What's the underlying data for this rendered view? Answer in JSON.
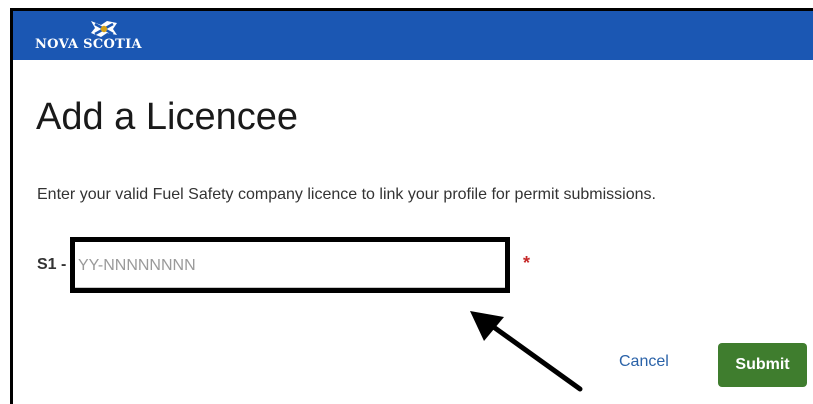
{
  "header": {
    "logo_text": "NOVA SCOTIA",
    "logo_icon": "nova-scotia-flag-icon",
    "background_color": "#1b57b3"
  },
  "main": {
    "title": "Add a Licencee",
    "instructions": "Enter your valid Fuel Safety company licence to link your profile for permit submissions.",
    "licence_field": {
      "prefix": "S1 -",
      "placeholder": "YY-NNNNNNNN",
      "value": "",
      "required_marker": "*"
    }
  },
  "actions": {
    "cancel_label": "Cancel",
    "submit_label": "Submit",
    "submit_color": "#3f7d2e"
  },
  "annotation": {
    "highlight_icon": "highlight-box",
    "arrow_icon": "pointer-arrow-icon"
  }
}
